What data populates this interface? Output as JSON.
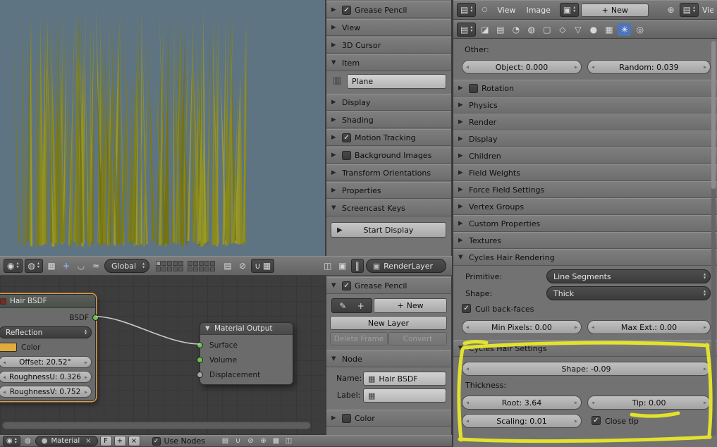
{
  "colors": {
    "viewport_bg": "#5e7482",
    "grass_rgb": [
      134,
      134,
      30
    ],
    "hair_color_swatch": "#e2ab3c",
    "highlight_marker": "#ebeb29",
    "tab_active": "#4f74b8"
  },
  "viewport_header": {
    "orientation": "Global",
    "render_layer": "RenderLayer"
  },
  "sidebar3d": {
    "panels": [
      {
        "label": "Grease Pencil"
      },
      {
        "label": "View"
      },
      {
        "label": "3D Cursor"
      },
      {
        "label": "Item"
      },
      {
        "label": "Display"
      },
      {
        "label": "Shading"
      },
      {
        "label": "Motion Tracking"
      },
      {
        "label": "Background Images"
      },
      {
        "label": "Transform Orientations"
      },
      {
        "label": "Properties"
      },
      {
        "label": "Screencast Keys"
      }
    ],
    "item_name_value": "Plane",
    "start_display_label": "Start Display"
  },
  "node_editor": {
    "hair_node": {
      "title": "Hair BSDF",
      "output_label": "BSDF",
      "component_value": "Reflection",
      "color_label": "Color",
      "offset_slider": "Offset: 20.52°",
      "roughness_u_slider": "RoughnessU: 0.326",
      "roughness_v_slider": "RoughnessV: 0.752"
    },
    "output_node": {
      "title": "Material Output",
      "inputs": [
        "Surface",
        "Volume",
        "Displacement"
      ]
    }
  },
  "node_sidebar": {
    "grease_pencil_title": "Grease Pencil",
    "new_button": "New",
    "new_layer_button": "New Layer",
    "delete_frame_button": "Delete Frame",
    "convert_button": "Convert",
    "node_panel_title": "Node",
    "name_label": "Name:",
    "name_value": "Hair BSDF",
    "label_label": "Label:",
    "label_value": "",
    "color_panel_title": "Color"
  },
  "node_header": {
    "material_name": "Material",
    "fake_user_button": "F",
    "use_nodes_label": "Use Nodes"
  },
  "properties": {
    "menu_view": "View",
    "menu_image": "Image",
    "new_button": "New",
    "clipped_menu": "View",
    "other_label": "Other:",
    "object_slider": "Object: 0.000",
    "random_slider": "Random: 0.039",
    "collapsed_panels": [
      "Rotation",
      "Physics",
      "Render",
      "Display",
      "Children",
      "Field Weights",
      "Force Field Settings",
      "Vertex Groups",
      "Custom Properties",
      "Textures"
    ],
    "hair_rendering": {
      "title": "Cycles Hair Rendering",
      "primitive_label": "Primitive:",
      "primitive_value": "Line Segments",
      "shape_label": "Shape:",
      "shape_value": "Thick",
      "cull_label": "Cull back-faces",
      "min_pixels_slider": "Min Pixels: 0.00",
      "max_ext_slider": "Max Ext.: 0.00"
    },
    "hair_settings": {
      "title": "Cycles Hair Settings",
      "shape_slider": "Shape: -0.09",
      "thickness_label": "Thickness:",
      "root_slider": "Root: 3.64",
      "tip_slider": "Tip: 0.00",
      "scaling_slider": "Scaling: 0.01",
      "close_tip_label": "Close tip"
    }
  }
}
